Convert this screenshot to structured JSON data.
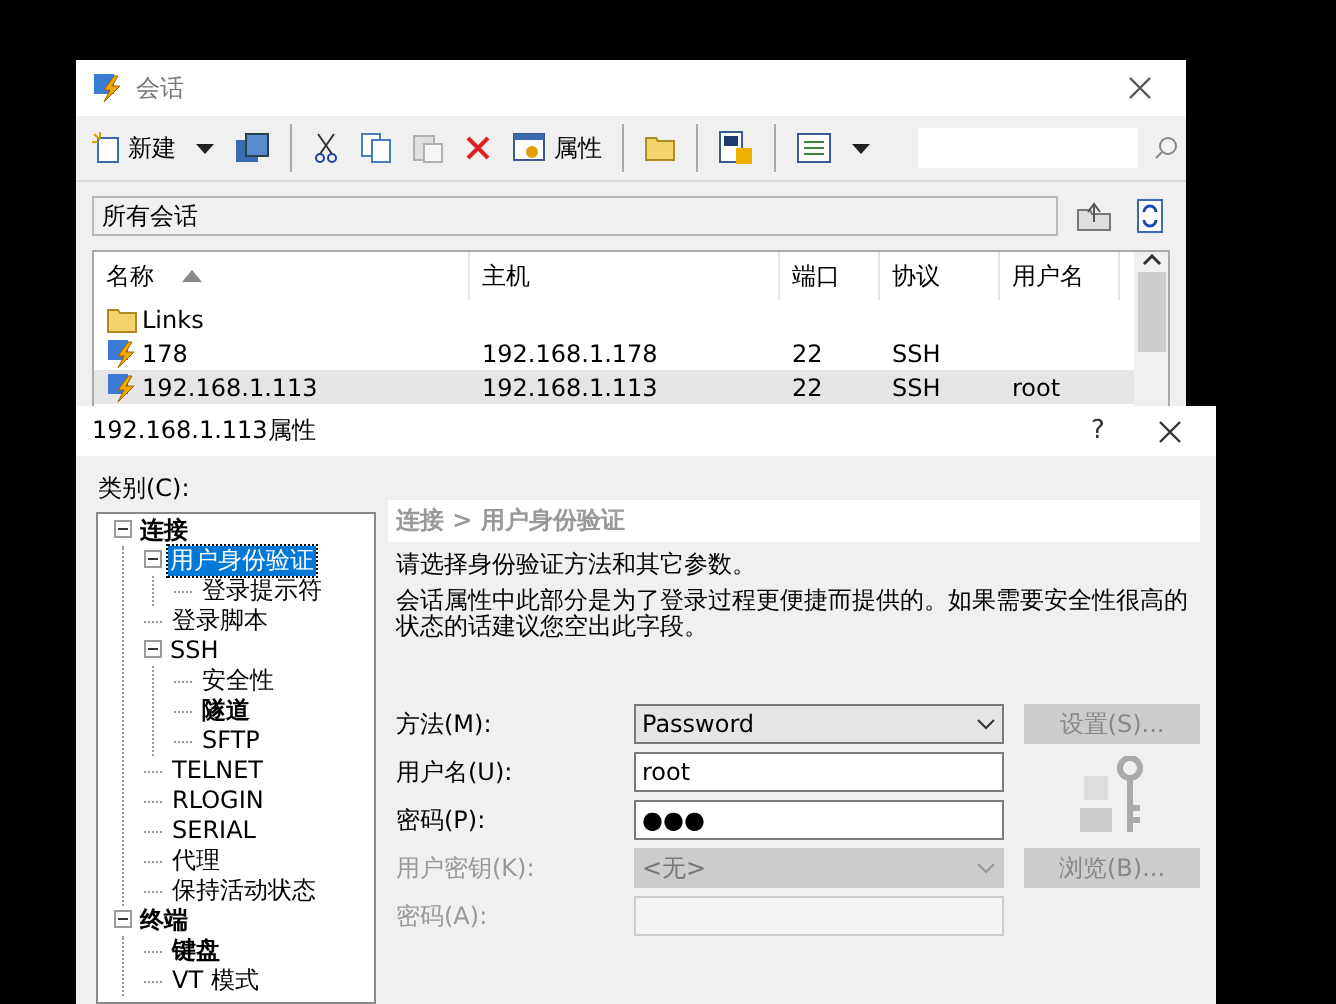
{
  "sessions_window": {
    "title": "会话",
    "toolbar": {
      "new_label": "新建",
      "properties_label": "属性",
      "paste_disabled": true
    },
    "path": "所有会话",
    "table": {
      "columns": [
        {
          "label": "名称",
          "sorted": true
        },
        {
          "label": "主机",
          "sorted": false
        },
        {
          "label": "端口",
          "sorted": false
        },
        {
          "label": "协议",
          "sorted": false
        },
        {
          "label": "用户名",
          "sorted": false
        }
      ],
      "rows": [
        {
          "kind": "folder",
          "name": "Links",
          "selected": false
        },
        {
          "kind": "session",
          "name": "178",
          "host": "192.168.1.178",
          "port": "22",
          "protocol": "SSH",
          "selected": false
        },
        {
          "kind": "session",
          "name": "192.168.1.113",
          "host": "192.168.1.113",
          "port": "22",
          "protocol": "SSH",
          "user": "root",
          "selected": true
        }
      ]
    }
  },
  "properties_dialog": {
    "title": "192.168.1.113属性",
    "help": "?",
    "category_label": "类别(C):",
    "tree": [
      {
        "label": "连接",
        "bold": true,
        "selected": false,
        "expanded": true,
        "children": [
          {
            "label": "用户身份验证",
            "bold": false,
            "selected": true,
            "expanded": true,
            "children": [
              {
                "label": "登录提示符",
                "bold": false,
                "selected": false
              }
            ]
          },
          {
            "label": "登录脚本",
            "bold": false,
            "selected": false
          },
          {
            "label": "SSH",
            "bold": false,
            "selected": false,
            "expanded": true,
            "children": [
              {
                "label": "安全性",
                "bold": false,
                "selected": false
              },
              {
                "label": "隧道",
                "bold": true,
                "selected": false
              },
              {
                "label": "SFTP",
                "bold": false,
                "selected": false
              }
            ]
          },
          {
            "label": "TELNET",
            "bold": false,
            "selected": false
          },
          {
            "label": "RLOGIN",
            "bold": false,
            "selected": false
          },
          {
            "label": "SERIAL",
            "bold": false,
            "selected": false
          },
          {
            "label": "代理",
            "bold": false,
            "selected": false
          },
          {
            "label": "保持活动状态",
            "bold": false,
            "selected": false
          }
        ]
      },
      {
        "label": "终端",
        "bold": true,
        "selected": false,
        "expanded": true,
        "children": [
          {
            "label": "键盘",
            "bold": true,
            "selected": false
          },
          {
            "label": "VT 模式",
            "bold": false,
            "selected": false
          }
        ]
      }
    ],
    "breadcrumb": "连接 > 用户身份验证",
    "intro": "请选择身份验证方法和其它参数。",
    "note": "会话属性中此部分是为了登录过程更便捷而提供的。如果需要安全性很高的状态的话建议您空出此字段。",
    "fields": [
      {
        "kind": "select",
        "label": "方法(M):",
        "value": "Password",
        "disabled": false
      },
      {
        "kind": "text",
        "label": "用户名(U):",
        "value": "root",
        "disabled": false
      },
      {
        "kind": "text",
        "label": "密码(P):",
        "value": "●●●",
        "disabled": false
      },
      {
        "kind": "select",
        "label": "用户密钥(K):",
        "value": "<无>",
        "disabled": true
      },
      {
        "kind": "text",
        "label": "密码(A):",
        "disabled": true
      }
    ],
    "buttons": [
      {
        "label": "设置(S)...",
        "disabled": true
      },
      {
        "label": "浏览(B)...",
        "disabled": true
      }
    ]
  }
}
